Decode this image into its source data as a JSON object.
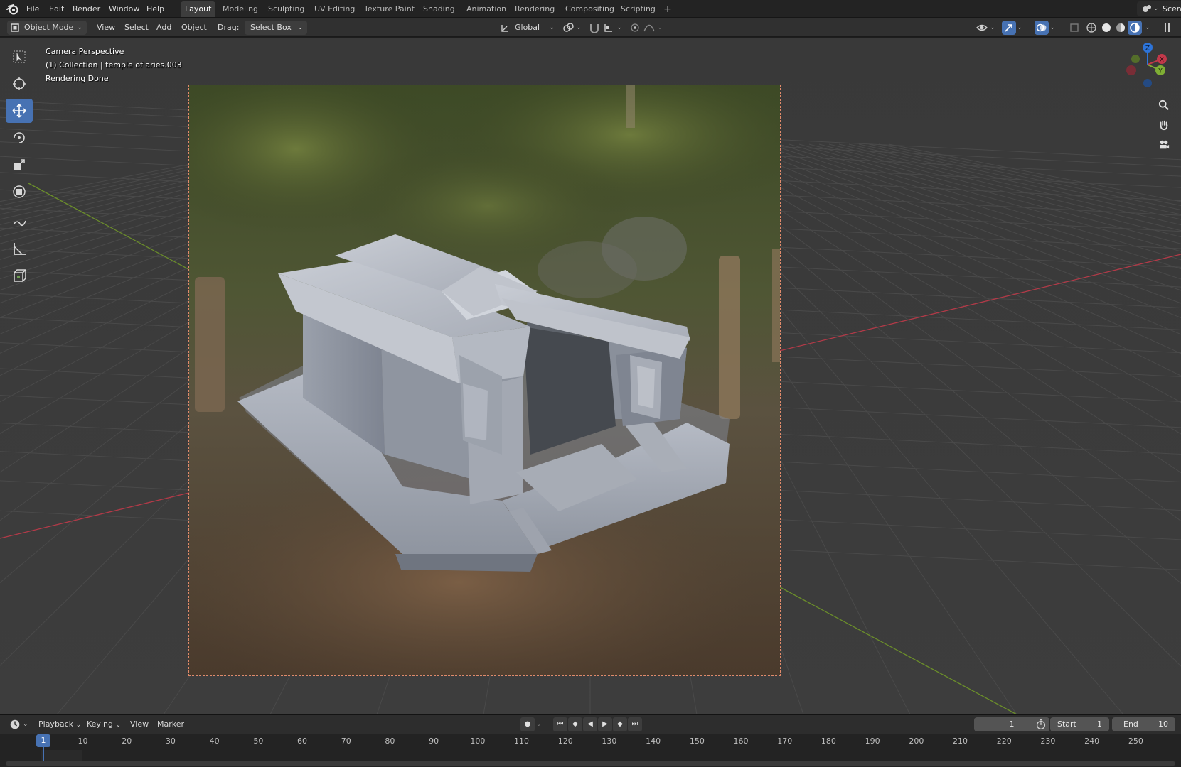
{
  "topbar": {
    "menus": [
      "File",
      "Edit",
      "Render",
      "Window",
      "Help"
    ],
    "workspace_tabs": [
      "Layout",
      "Modeling",
      "Sculpting",
      "UV Editing",
      "Texture Paint",
      "Shading",
      "Animation",
      "Rendering",
      "Compositing",
      "Scripting"
    ],
    "active_tab": "Layout",
    "add_tab": "+",
    "scene_label": "Scen"
  },
  "viewport_header": {
    "mode": "Object Mode",
    "menus": [
      "View",
      "Select",
      "Add",
      "Object"
    ],
    "drag_label": "Drag:",
    "drag_value": "Select Box",
    "transform_orientation": "Global"
  },
  "viewport": {
    "overlay": {
      "line1": "Camera Perspective",
      "line2": "(1) Collection | temple of aries.003",
      "line3": "Rendering Done"
    },
    "gizmo_axes": [
      "X",
      "Y",
      "Z"
    ],
    "tools": [
      "select-box",
      "cursor",
      "move",
      "rotate",
      "scale",
      "transform",
      "annotate",
      "measure",
      "add-cube"
    ],
    "active_tool": "move"
  },
  "timeline": {
    "menus": [
      "Playback",
      "Keying",
      "View",
      "Marker"
    ],
    "current_frame": "1",
    "start_label": "Start",
    "start_value": "1",
    "end_label": "End",
    "end_value": "10",
    "ruler_ticks": [
      "1",
      "10",
      "20",
      "30",
      "40",
      "50",
      "60",
      "70",
      "80",
      "90",
      "100",
      "110",
      "120",
      "130",
      "140",
      "150",
      "160",
      "170",
      "180",
      "190",
      "200",
      "210",
      "220",
      "230",
      "240",
      "250"
    ],
    "playhead_frame": "1"
  },
  "colors": {
    "accent": "#4772b3",
    "x_axis": "#c2384a",
    "y_axis": "#7fae34",
    "z_axis": "#2d74d9",
    "camera_frame": "#e08a6a"
  }
}
